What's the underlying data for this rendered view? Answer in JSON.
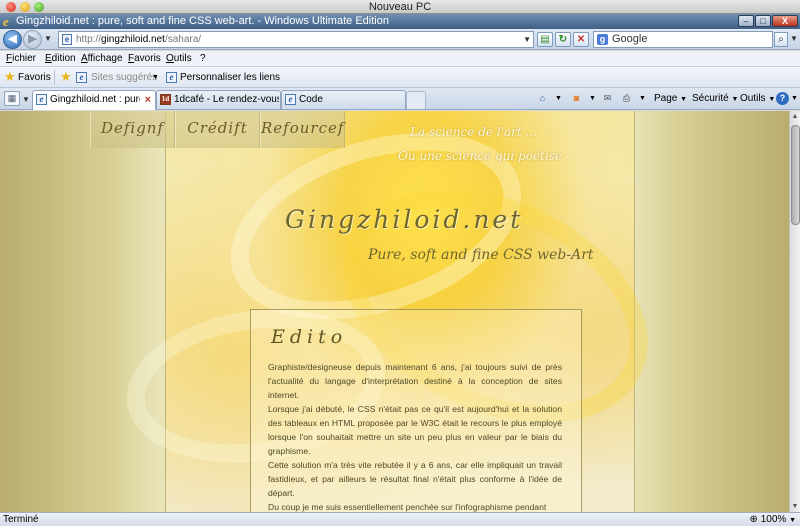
{
  "mac_window": {
    "title": "Nouveau PC"
  },
  "ie_window": {
    "title": "Gingzhiloid.net : pure, soft and fine CSS web-art. - Windows Ultimate Edition",
    "controls": {
      "minimize": "–",
      "maximize": "□",
      "close": "X"
    }
  },
  "address_bar": {
    "url_prefix": "http://",
    "url_host": "gingzhiloid.net",
    "url_path": "/sahara/",
    "search_engine": "Google",
    "search_placeholder": "Google"
  },
  "menu": {
    "items": [
      "Fichier",
      "Edition",
      "Affichage",
      "Favoris",
      "Outils",
      "?"
    ]
  },
  "favorites_bar": {
    "favorites_label": "Favoris",
    "suggested_label": "Sites suggérés",
    "customize_label": "Personnaliser les liens"
  },
  "tabs": [
    {
      "label": "Gingzhiloid.net : pure, ...",
      "icon": "ie-page-icon",
      "active": true
    },
    {
      "label": "1dcafé - Le rendez-vous d...",
      "icon": "1dcafe-icon",
      "active": false
    },
    {
      "label": "Code",
      "icon": "ie-page-icon",
      "active": false
    }
  ],
  "command_bar": {
    "page": "Page",
    "security": "Sécurité",
    "tools": "Outils",
    "help": "?"
  },
  "site": {
    "nav": [
      "Defignf",
      "Crédift",
      "Refourcef"
    ],
    "tagline_1": "La science de l'art ...",
    "tagline_2": "Ou une science qui poétise",
    "brand": "Gingzhiloid.net",
    "subtitle": "Pure, soft and fine CSS web-Art",
    "edito_title": "Edito",
    "edito_paragraphs": [
      "Graphiste/designeuse depuis maintenant 6 ans, j'ai toujours suivi de près l'actualité du langage d'interprétation destiné à la conception de sites internet.",
      "Lorsque j'ai débuté, le CSS n'était pas ce qu'il est aujourd'hui et la solution des tableaux en HTML proposée par le W3C était le recours le plus employé lorsque l'on souhaitait mettre un site un peu plus en valeur par le biais du graphisme.",
      "Cette solution m'a très vite rebutée il y a 6 ans, car elle impliquait un travail fastidieux, et par ailleurs le résultat final n'était plus conforme à l'idée de départ.",
      "Du coup je me suis essentiellement penchée sur l'infographisme pendant"
    ]
  },
  "status_bar": {
    "status": "Terminé",
    "zoom": "100%"
  },
  "colors": {
    "site_yellow": "#f8cd28",
    "text_brown": "#4f4826",
    "ie_caption_blue": "#3f5f85"
  }
}
